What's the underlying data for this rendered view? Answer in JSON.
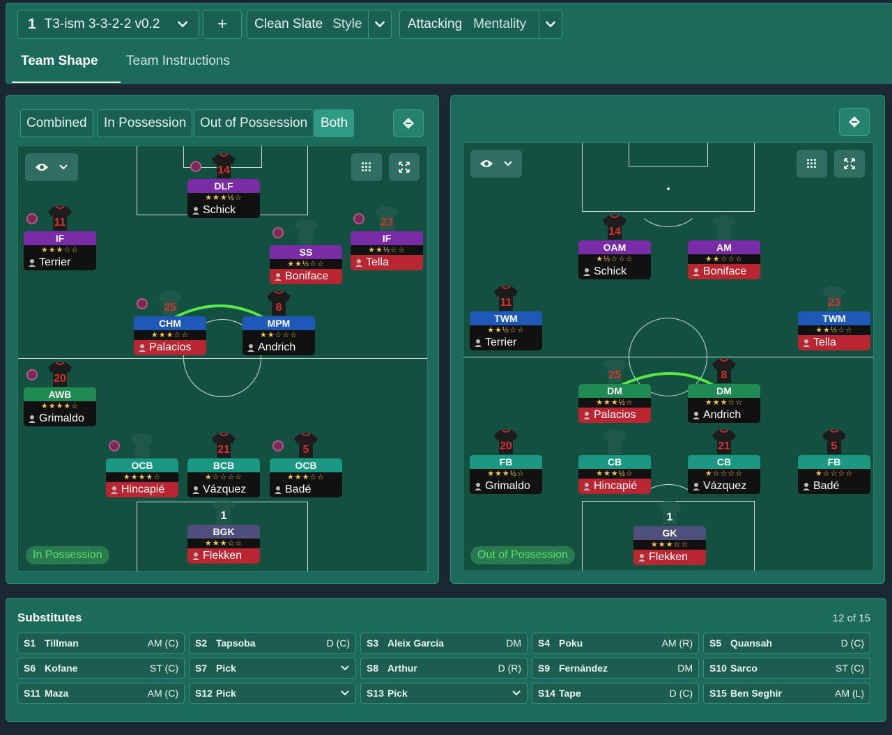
{
  "tactic": {
    "number": "1",
    "name": "T3-ism 3-3-2-2 v0.2",
    "add": "+"
  },
  "style": {
    "value": "Clean Slate",
    "label": "Style"
  },
  "mentality": {
    "value": "Attacking",
    "label": "Mentality"
  },
  "tabs": [
    "Team Shape",
    "Team Instructions"
  ],
  "view_modes": [
    "Combined",
    "In Possession",
    "Out of Possession",
    "Both"
  ],
  "left_label": "In Possession",
  "right_label": "Out of Possession",
  "in_possession": [
    {
      "num": "14",
      "role": "DLF",
      "stars": "★★★½☆",
      "name": "Schick",
      "color": "purple",
      "red": false,
      "shirt": true,
      "mood": true
    },
    {
      "num": "11",
      "role": "IF",
      "stars": "★★★☆☆",
      "name": "Terrier",
      "color": "purple",
      "red": false,
      "shirt": true,
      "mood": true
    },
    {
      "num": "",
      "role": "SS",
      "stars": "★★½☆☆",
      "name": "Boniface",
      "color": "purple",
      "red": true,
      "shirt": false,
      "mood": true
    },
    {
      "num": "23",
      "role": "IF",
      "stars": "★★½☆☆",
      "name": "Tella",
      "color": "purple",
      "red": true,
      "shirt": false,
      "mood": true
    },
    {
      "num": "25",
      "role": "CHM",
      "stars": "★★★☆☆",
      "name": "Palacios",
      "color": "blue",
      "red": true,
      "shirt": false,
      "mood": true
    },
    {
      "num": "8",
      "role": "MPM",
      "stars": "★★☆☆☆",
      "name": "Andrich",
      "color": "blue",
      "red": false,
      "shirt": true,
      "mood": false
    },
    {
      "num": "20",
      "role": "AWB",
      "stars": "★★★★☆",
      "name": "Grimaldo",
      "color": "green",
      "red": false,
      "shirt": true,
      "mood": true
    },
    {
      "num": "",
      "role": "OCB",
      "stars": "★★★★☆",
      "name": "Hincapié",
      "color": "teal",
      "red": true,
      "shirt": false,
      "mood": true
    },
    {
      "num": "21",
      "role": "BCB",
      "stars": "★☆☆☆☆",
      "name": "Vázquez",
      "color": "teal",
      "red": false,
      "shirt": true,
      "mood": false
    },
    {
      "num": "5",
      "role": "OCB",
      "stars": "★★★☆☆",
      "name": "Badé",
      "color": "teal",
      "red": false,
      "shirt": true,
      "mood": true
    },
    {
      "num": "1",
      "role": "BGK",
      "stars": "★★★☆☆",
      "name": "Flekken",
      "color": "slate",
      "red": true,
      "shirt": false,
      "mood": false
    }
  ],
  "out_possession": [
    {
      "num": "14",
      "role": "OAM",
      "stars": "★½☆☆☆",
      "name": "Schick",
      "color": "purple",
      "red": false,
      "shirt": true
    },
    {
      "num": "",
      "role": "AM",
      "stars": "★★☆☆☆",
      "name": "Boniface",
      "color": "purple",
      "red": true,
      "shirt": false
    },
    {
      "num": "11",
      "role": "TWM",
      "stars": "★★½☆☆",
      "name": "Terrier",
      "color": "blue",
      "red": false,
      "shirt": true
    },
    {
      "num": "23",
      "role": "TWM",
      "stars": "★★½☆☆",
      "name": "Tella",
      "color": "blue",
      "red": true,
      "shirt": false
    },
    {
      "num": "25",
      "role": "DM",
      "stars": "★★★½☆",
      "name": "Palacios",
      "color": "green",
      "red": true,
      "shirt": false
    },
    {
      "num": "8",
      "role": "DM",
      "stars": "★★★☆☆",
      "name": "Andrich",
      "color": "green",
      "red": false,
      "shirt": true
    },
    {
      "num": "20",
      "role": "FB",
      "stars": "★★★½☆",
      "name": "Grimaldo",
      "color": "teal",
      "red": false,
      "shirt": true
    },
    {
      "num": "",
      "role": "CB",
      "stars": "★★★½☆",
      "name": "Hincapié",
      "color": "teal",
      "red": true,
      "shirt": false
    },
    {
      "num": "21",
      "role": "CB",
      "stars": "★☆☆☆☆",
      "name": "Vázquez",
      "color": "teal",
      "red": false,
      "shirt": true
    },
    {
      "num": "5",
      "role": "FB",
      "stars": "★☆☆☆☆",
      "name": "Badé",
      "color": "teal",
      "red": false,
      "shirt": true
    },
    {
      "num": "1",
      "role": "GK",
      "stars": "★★★☆☆",
      "name": "Flekken",
      "color": "slate",
      "red": true,
      "shirt": false
    }
  ],
  "substitutes": {
    "title": "Substitutes",
    "count": "12 of 15",
    "items": [
      {
        "slot": "S1",
        "name": "Tillman",
        "pos": "AM (C)"
      },
      {
        "slot": "S2",
        "name": "Tapsoba",
        "pos": "D (C)"
      },
      {
        "slot": "S3",
        "name": "Aleix García",
        "pos": "DM"
      },
      {
        "slot": "S4",
        "name": "Poku",
        "pos": "AM (R)"
      },
      {
        "slot": "S5",
        "name": "Quansah",
        "pos": "D (C)"
      },
      {
        "slot": "S6",
        "name": "Kofane",
        "pos": "ST (C)"
      },
      {
        "slot": "S7",
        "name": "Pick",
        "pos": "",
        "dropdown": true
      },
      {
        "slot": "S8",
        "name": "Arthur",
        "pos": "D (R)"
      },
      {
        "slot": "S9",
        "name": "Fernández",
        "pos": "DM"
      },
      {
        "slot": "S10",
        "name": "Sarco",
        "pos": "ST (C)"
      },
      {
        "slot": "S11",
        "name": "Maza",
        "pos": "AM (C)"
      },
      {
        "slot": "S12",
        "name": "Pick",
        "pos": "",
        "dropdown": true
      },
      {
        "slot": "S13",
        "name": "Pick",
        "pos": "",
        "dropdown": true
      },
      {
        "slot": "S14",
        "name": "Tape",
        "pos": "D (C)"
      },
      {
        "slot": "S15",
        "name": "Ben Seghir",
        "pos": "AM (L)"
      }
    ]
  },
  "colors": {
    "panel": "#1c6a5b",
    "pitch": "#14503f",
    "link_line": "#58e848",
    "star": "#f2c94c",
    "unhappy": "#b92632"
  },
  "icons": [
    "chevron-down-icon",
    "plus-icon",
    "tactics-board-icon",
    "eye-icon",
    "grid-icon",
    "expand-icon"
  ]
}
